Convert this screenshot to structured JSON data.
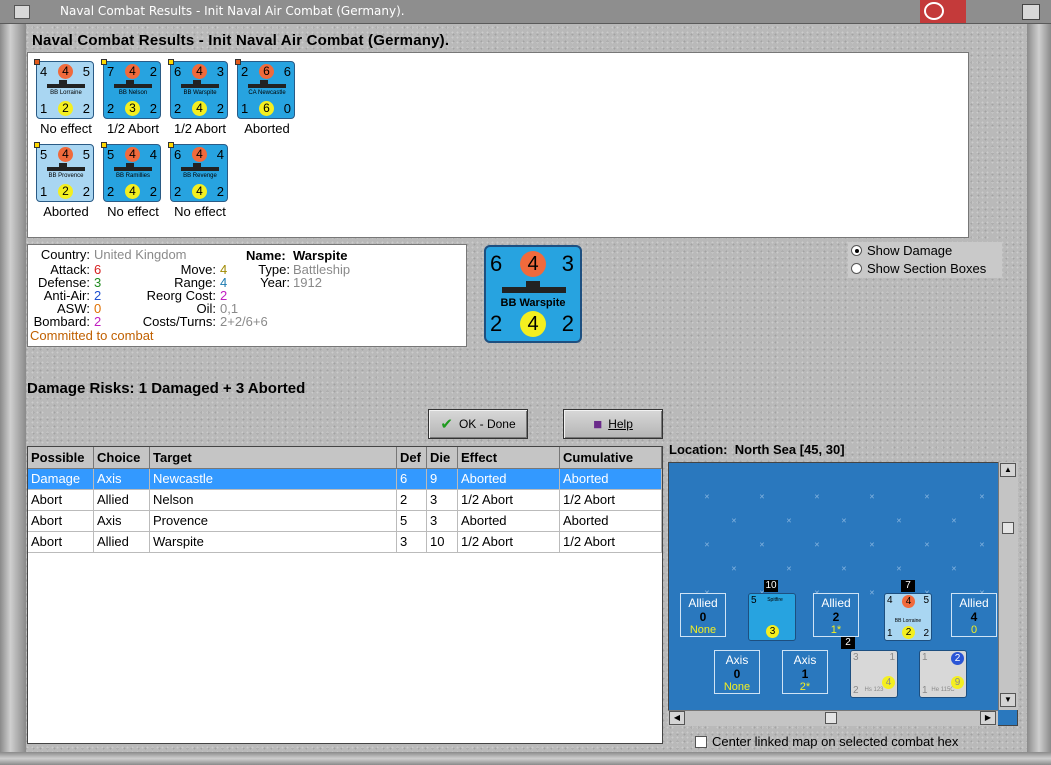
{
  "window": {
    "title": "Naval Combat Results - Init Naval Air Combat (Germany)."
  },
  "dialog_title": "Naval Combat Results - Init Naval Air Combat (Germany).",
  "results": [
    {
      "name": "BB Lorraine",
      "tl": "4",
      "top": "4",
      "tr": "5",
      "bl": "1",
      "bot": "2",
      "br": "2",
      "result": "No effect",
      "style": "light",
      "marker": "orange"
    },
    {
      "name": "BB Nelson",
      "tl": "7",
      "top": "4",
      "tr": "2",
      "bl": "2",
      "bot": "3",
      "br": "2",
      "result": "1/2 Abort",
      "style": "dark",
      "marker": "yellow"
    },
    {
      "name": "BB Warspite",
      "tl": "6",
      "top": "4",
      "tr": "3",
      "bl": "2",
      "bot": "4",
      "br": "2",
      "result": "1/2 Abort",
      "style": "dark",
      "marker": "yellow"
    },
    {
      "name": "CA Newcastle",
      "tl": "2",
      "top": "6",
      "tr": "6",
      "bl": "1",
      "bot": "6",
      "br": "0",
      "result": "Aborted",
      "style": "dark",
      "marker": "orange"
    },
    {
      "name": "BB Provence",
      "tl": "5",
      "top": "4",
      "tr": "5",
      "bl": "1",
      "bot": "2",
      "br": "2",
      "result": "Aborted",
      "style": "light",
      "marker": "yellow"
    },
    {
      "name": "BB Ramillies",
      "tl": "5",
      "top": "4",
      "tr": "4",
      "bl": "2",
      "bot": "4",
      "br": "2",
      "result": "No effect",
      "style": "dark",
      "marker": "yellow"
    },
    {
      "name": "BB Revenge",
      "tl": "6",
      "top": "4",
      "tr": "4",
      "bl": "2",
      "bot": "4",
      "br": "2",
      "result": "No effect",
      "style": "dark",
      "marker": "yellow"
    }
  ],
  "info": {
    "country_label": "Country:",
    "country": "United Kingdom",
    "attack_label": "Attack:",
    "attack": "6",
    "defense_label": "Defense:",
    "defense": "3",
    "antiair_label": "Anti-Air:",
    "antiair": "2",
    "asw_label": "ASW:",
    "asw": "0",
    "bombard_label": "Bombard:",
    "bombard": "2",
    "committed": "Committed to combat",
    "move_label": "Move:",
    "move": "4",
    "range_label": "Range:",
    "range": "4",
    "reorg_label": "Reorg Cost:",
    "reorg": "2",
    "oil_label": "Oil:",
    "oil": "0,1",
    "costs_label": "Costs/Turns:",
    "costs": "2+2/6+6",
    "name_label": "Name:",
    "name": "Warspite",
    "type_label": "Type:",
    "type": "Battleship",
    "year_label": "Year:",
    "year": "1912"
  },
  "big_unit": {
    "name": "BB Warspite",
    "tl": "6",
    "top": "4",
    "tr": "3",
    "bl": "2",
    "bot": "4",
    "br": "2"
  },
  "options": {
    "show_damage": "Show Damage",
    "show_sections": "Show Section Boxes"
  },
  "damage_risks": "Damage Risks:  1 Damaged + 3 Aborted",
  "buttons": {
    "ok": "OK - Done",
    "help": "Help"
  },
  "table": {
    "headers": [
      "Possible",
      "Choice",
      "Target",
      "Def",
      "Die",
      "Effect",
      "Cumulative"
    ],
    "rows": [
      [
        "Damage",
        "Axis",
        "Newcastle",
        "6",
        "9",
        "Aborted",
        "Aborted"
      ],
      [
        "Abort",
        "Allied",
        "Nelson",
        "2",
        "3",
        "1/2 Abort",
        "1/2 Abort"
      ],
      [
        "Abort",
        "Axis",
        "Provence",
        "5",
        "3",
        "Aborted",
        "Aborted"
      ],
      [
        "Abort",
        "Allied",
        "Warspite",
        "3",
        "10",
        "1/2 Abort",
        "1/2 Abort"
      ]
    ]
  },
  "location": {
    "label": "Location:",
    "value": "North Sea [45, 30]"
  },
  "map": {
    "allied_boxes": [
      {
        "side": "Allied",
        "value": "0",
        "sub": "None"
      },
      {
        "side": "Allied",
        "value": "2",
        "sub": "1*"
      },
      {
        "side": "Allied",
        "value": "4",
        "sub": "0"
      }
    ],
    "axis_boxes": [
      {
        "side": "Axis",
        "value": "0",
        "sub": "None"
      },
      {
        "side": "Axis",
        "value": "1",
        "sub": "2*"
      }
    ],
    "stack_numbers": [
      "10",
      "7",
      "2"
    ],
    "units": {
      "spitfire": {
        "name": "Spitfire",
        "tl": "5",
        "c": "3"
      },
      "lorraine": {
        "name": "BB Lorraine",
        "tl": "4",
        "top": "4",
        "tr": "5",
        "bl": "1",
        "bot": "2",
        "br": "2"
      },
      "hs123": {
        "name": "Hs 123",
        "tl": "3",
        "tr": "1",
        "bl": "2",
        "c": "4"
      },
      "he115": {
        "name": "He 115C",
        "tl": "1",
        "top": "2",
        "bl": "1",
        "c": "9"
      }
    }
  },
  "center_map_label": "Center linked map on selected combat hex"
}
